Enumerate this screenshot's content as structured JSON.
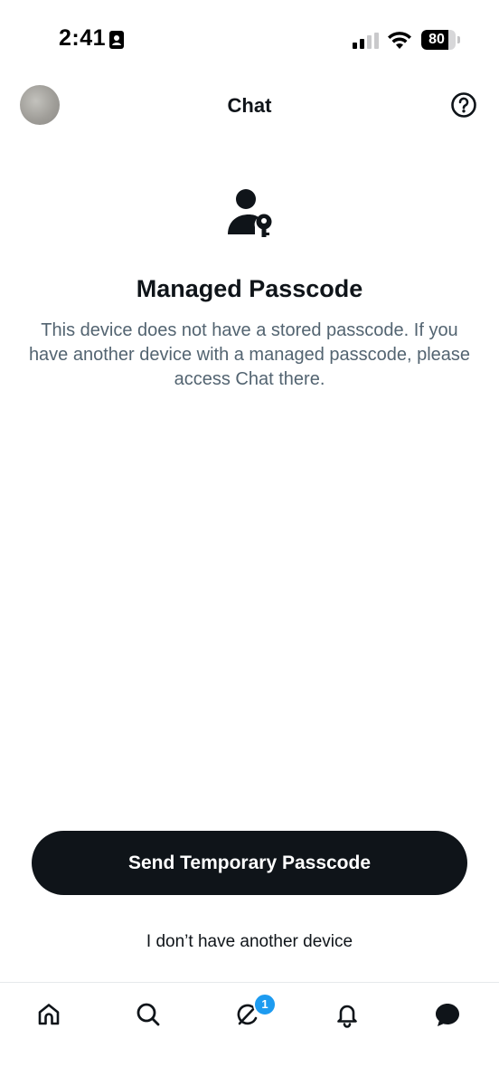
{
  "status_bar": {
    "time": "2:41",
    "battery_percent": "80",
    "battery_level": 0.8
  },
  "header": {
    "title": "Chat"
  },
  "main": {
    "title": "Managed Passcode",
    "description": "This device does not have a stored passcode. If you have another device with a managed passcode, please access Chat there."
  },
  "actions": {
    "primary_label": "Send Temporary Passcode",
    "secondary_label": "I don’t have another device"
  },
  "tab_bar": {
    "items": [
      {
        "icon": "home-icon"
      },
      {
        "icon": "search-icon"
      },
      {
        "icon": "grok-icon",
        "badge": "1"
      },
      {
        "icon": "bell-icon"
      },
      {
        "icon": "chat-bubble-icon",
        "active": true
      }
    ]
  },
  "colors": {
    "primary_button_bg": "#0f1419",
    "description_text": "#536471",
    "badge": "#1d9bf0"
  }
}
